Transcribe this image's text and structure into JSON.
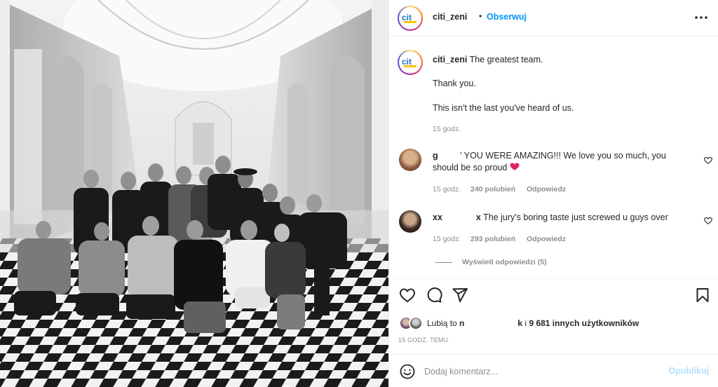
{
  "post": {
    "author": "citi_zeni",
    "follow_label": "Obserwuj",
    "dot": "•",
    "caption_lines": [
      "The greatest team.",
      "Thank you.",
      "This isn't the last you've heard of us."
    ],
    "caption_time": "15 godz."
  },
  "comments": [
    {
      "user": "g",
      "text_line1": "' YOU WERE AMAZING!!! We love you so much, you",
      "text_line2": "should be so proud",
      "time": "15 godz.",
      "likes": "240 polubień",
      "reply": "Odpowiedz"
    },
    {
      "user": "xx",
      "user_end": "x",
      "text": "The jury's boring taste just screwed u guys over",
      "time": "15 godz.",
      "likes": "293 polubień",
      "reply": "Odpowiedz",
      "view_replies": "Wyświetl odpowiedzi (5)"
    }
  ],
  "likes_line": {
    "prefix": "Lubią to",
    "name_start": "n",
    "name_end": "k",
    "connector": "i",
    "others": "9 681 innych użytkowników"
  },
  "posted_ago": "15 GODZ. TEMU",
  "composer": {
    "placeholder": "Dodaj komentarz...",
    "publish_label": "Opublikuj"
  },
  "colors": {
    "follow": "#0095f6",
    "publish_disabled": "#b2dffc",
    "secondary_text": "#8e8e8e",
    "emoji_heart": "#e0245e"
  },
  "icons": [
    "more-icon",
    "heart-icon",
    "comment-icon",
    "share-icon",
    "bookmark-icon",
    "emoji-icon",
    "small-heart-icon"
  ]
}
